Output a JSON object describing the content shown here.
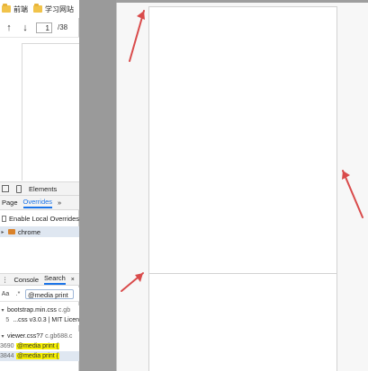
{
  "bookmarks_bar": {
    "items": [
      {
        "label": "前端",
        "icon": "folder-icon"
      },
      {
        "label": "学习网站",
        "icon": "folder-icon"
      }
    ]
  },
  "pdf_toolbar": {
    "current_page": "1",
    "page_total": "/38"
  },
  "devtools": {
    "top_tabs": {
      "elements_label": "Elements"
    },
    "sources_tabs": {
      "page_label": "Page",
      "overrides_label": "Overrides",
      "more_label": "»"
    },
    "overrides": {
      "enable_local_label": "Enable Local Overrides",
      "folder_label": "chrome"
    },
    "drawer_tabs": {
      "console_label": "Console",
      "search_label": "Search",
      "close_label": "×"
    },
    "search": {
      "case_label": "Aa",
      "regex_label": ".*",
      "query": "@media print"
    },
    "results": [
      {
        "file_name": "bootstrap.min.css",
        "file_path": "c.gb",
        "matches": [
          {
            "line": "5",
            "text": "...css v3.0.3 | MIT Licen"
          }
        ]
      },
      {
        "file_name": "viewer.css?7",
        "file_path": "c.gb688.c",
        "matches": [
          {
            "line": "3690",
            "text": "@media print {"
          },
          {
            "line": "3844",
            "text": "@media print {"
          }
        ]
      }
    ]
  },
  "colors": {
    "accent": "#1a73e8",
    "search_highlight": "#f8f200",
    "annotation_arrow": "#d94b4b"
  }
}
